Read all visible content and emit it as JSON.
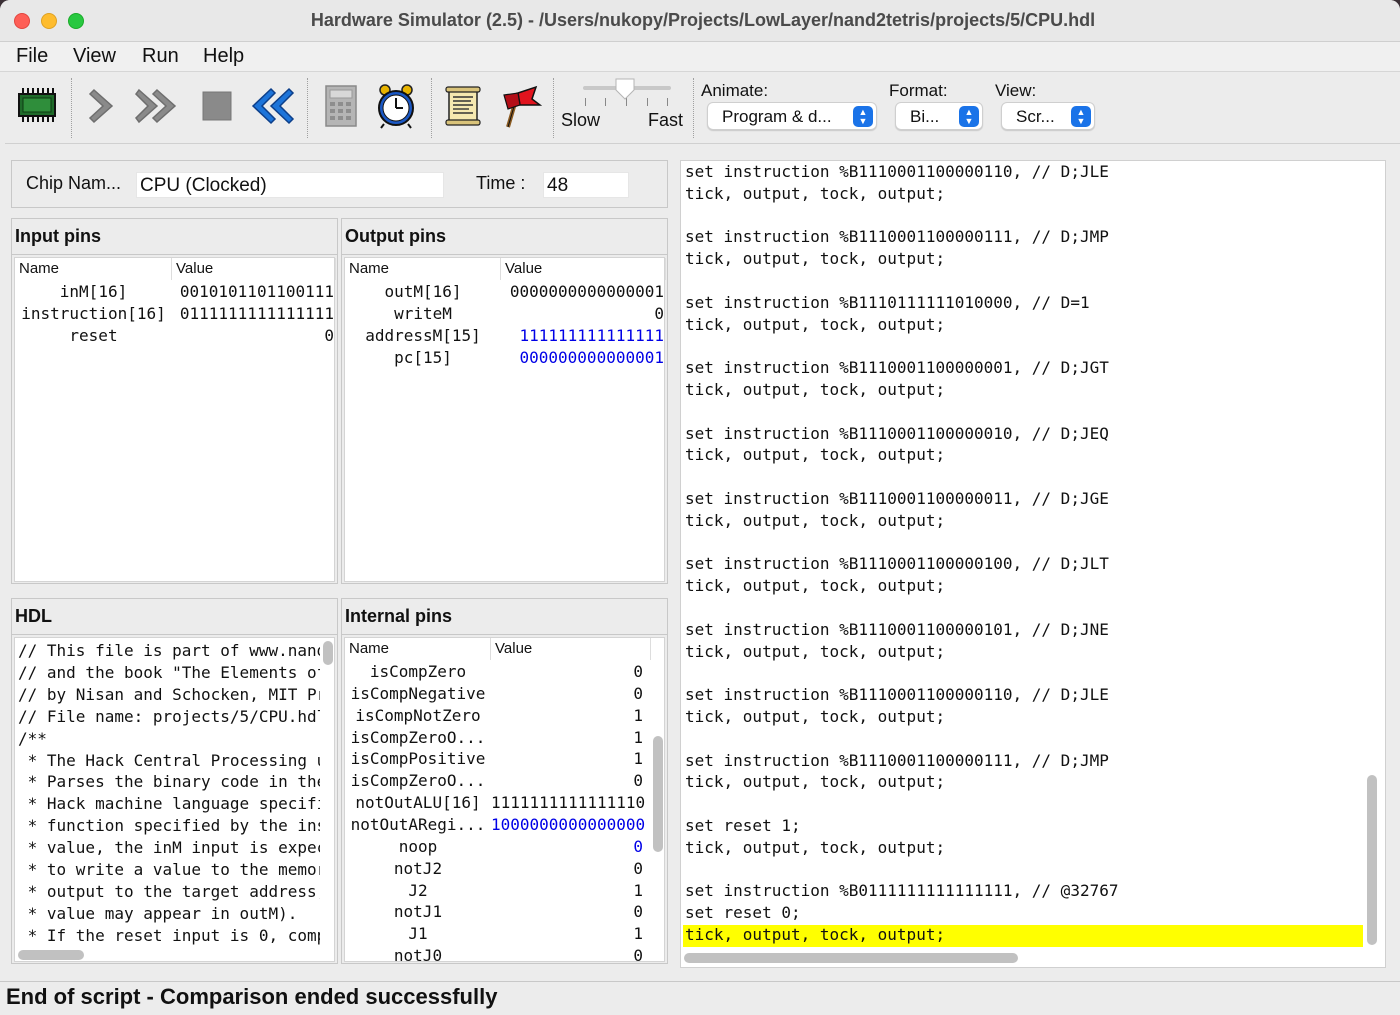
{
  "window": {
    "title": "Hardware Simulator (2.5) - /Users/nukopy/Projects/LowLayer/nand2tetris/projects/5/CPU.hdl"
  },
  "menu": [
    "File",
    "View",
    "Run",
    "Help"
  ],
  "toolbar": {
    "icons": [
      "load-chip-icon",
      "single-step-icon",
      "run-icon",
      "stop-icon",
      "reset-icon",
      "eval-icon",
      "clock-icon",
      "script-icon",
      "breakpoints-icon"
    ],
    "speed_slow": "Slow",
    "speed_fast": "Fast",
    "animate_label": "Animate:",
    "animate_value": "Program & d...",
    "format_label": "Format:",
    "format_value": "Bi...",
    "view_label": "View:",
    "view_value": "Scr..."
  },
  "chip": {
    "name_label": "Chip Nam...",
    "name_value": "CPU (Clocked)",
    "time_label": "Time :",
    "time_value": "48"
  },
  "input_pins": {
    "title": "Input pins",
    "col_name": "Name",
    "col_value": "Value",
    "rows": [
      {
        "name": "inM[16]",
        "value": "0010101101100111"
      },
      {
        "name": "instruction[16]",
        "value": "0111111111111111"
      },
      {
        "name": "reset",
        "value": "0"
      }
    ]
  },
  "output_pins": {
    "title": "Output pins",
    "col_name": "Name",
    "col_value": "Value",
    "rows": [
      {
        "name": "outM[16]",
        "value": "0000000000000001",
        "highlight": false
      },
      {
        "name": "writeM",
        "value": "0",
        "highlight": false
      },
      {
        "name": "addressM[15]",
        "value": "111111111111111",
        "highlight": true
      },
      {
        "name": "pc[15]",
        "value": "000000000000001",
        "highlight": true
      }
    ]
  },
  "hdl": {
    "title": "HDL",
    "lines": [
      "// This file is part of www.nand",
      "// and the book \"The Elements of",
      "// by Nisan and Schocken, MIT Pr",
      "// File name: projects/5/CPU.hdl",
      "/**",
      " * The Hack Central Processing u",
      " * Parses the binary code in the",
      " * Hack machine language specifi",
      " * function specified by the ins",
      " * value, the inM input is expec",
      " * to write a value to the memor",
      " * output to the target address,",
      " * value may appear in outM).",
      " * If the reset input is 0, comp"
    ]
  },
  "internal_pins": {
    "title": "Internal pins",
    "col_name": "Name",
    "col_value": "Value",
    "rows": [
      {
        "name": "isCompZero",
        "value": "0",
        "highlight": false
      },
      {
        "name": "isCompNegative",
        "value": "0",
        "highlight": false
      },
      {
        "name": "isCompNotZero",
        "value": "1",
        "highlight": false
      },
      {
        "name": "isCompZeroO...",
        "value": "1",
        "highlight": false
      },
      {
        "name": "isCompPositive",
        "value": "1",
        "highlight": false
      },
      {
        "name": "isCompZeroO...",
        "value": "0",
        "highlight": false
      },
      {
        "name": "notOutALU[16]",
        "value": "1111111111111110",
        "highlight": false
      },
      {
        "name": "notOutARegi...",
        "value": "1000000000000000",
        "highlight": true
      },
      {
        "name": "noop",
        "value": "0",
        "highlight": true
      },
      {
        "name": "notJ2",
        "value": "0",
        "highlight": false
      },
      {
        "name": "J2",
        "value": "1",
        "highlight": false
      },
      {
        "name": "notJ1",
        "value": "0",
        "highlight": false
      },
      {
        "name": "J1",
        "value": "1",
        "highlight": false
      },
      {
        "name": "notJ0",
        "value": "0",
        "highlight": false
      }
    ]
  },
  "script": {
    "lines": [
      "set instruction %B1110001100000110, // D;JLE",
      "tick, output, tock, output;",
      "",
      "set instruction %B1110001100000111, // D;JMP",
      "tick, output, tock, output;",
      "",
      "set instruction %B1110111111010000, // D=1",
      "tick, output, tock, output;",
      "",
      "set instruction %B1110001100000001, // D;JGT",
      "tick, output, tock, output;",
      "",
      "set instruction %B1110001100000010, // D;JEQ",
      "tick, output, tock, output;",
      "",
      "set instruction %B1110001100000011, // D;JGE",
      "tick, output, tock, output;",
      "",
      "set instruction %B1110001100000100, // D;JLT",
      "tick, output, tock, output;",
      "",
      "set instruction %B1110001100000101, // D;JNE",
      "tick, output, tock, output;",
      "",
      "set instruction %B1110001100000110, // D;JLE",
      "tick, output, tock, output;",
      "",
      "set instruction %B1110001100000111, // D;JMP",
      "tick, output, tock, output;",
      "",
      "set reset 1;",
      "tick, output, tock, output;",
      "",
      "set instruction %B0111111111111111, // @32767",
      "set reset 0;",
      "tick, output, tock, output;"
    ],
    "highlighted_index": 35
  },
  "status": "End of script - Comparison ended successfully",
  "colors": {
    "highlight": "#ffff00",
    "changed_value": "#0000e6"
  }
}
